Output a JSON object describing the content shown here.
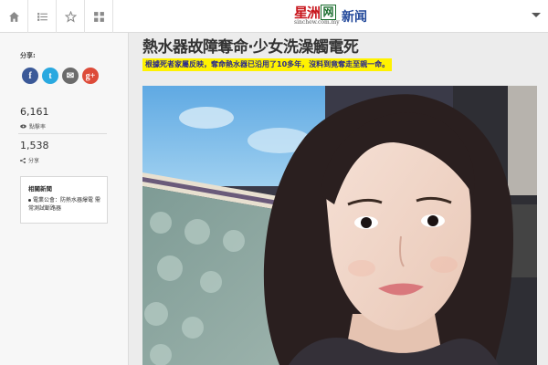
{
  "nav": {
    "home_icon": "home-icon",
    "list_icon": "list-icon",
    "star_icon": "star-icon",
    "grid_icon": "grid-icon"
  },
  "logo": {
    "cn_text": "星洲",
    "box_text": "网",
    "url": "sinchew.com.my",
    "section": "新闻"
  },
  "sidebar": {
    "share_label": "分享:",
    "social": {
      "facebook": "f",
      "twitter": "t",
      "email": "✉",
      "gplus": "g+"
    },
    "views_count": "6,161",
    "views_label": "點擊率",
    "shares_count": "1,538",
    "shares_label": "分享",
    "related_title": "相關新聞",
    "related_items": [
      "電業公會：防熱水器爆電 需常測試斷路器"
    ]
  },
  "article": {
    "headline": "熱水器故障奪命‧少女洗澡觸電死",
    "subhead": "根據死者家屬反映，奪命熱水器已沿用了10多年，沒料到竟奪走至親一命。"
  },
  "colors": {
    "brand_red": "#c8161d",
    "brand_green": "#1b6e2f",
    "news_blue": "#22489a",
    "highlight": "#fff200"
  }
}
